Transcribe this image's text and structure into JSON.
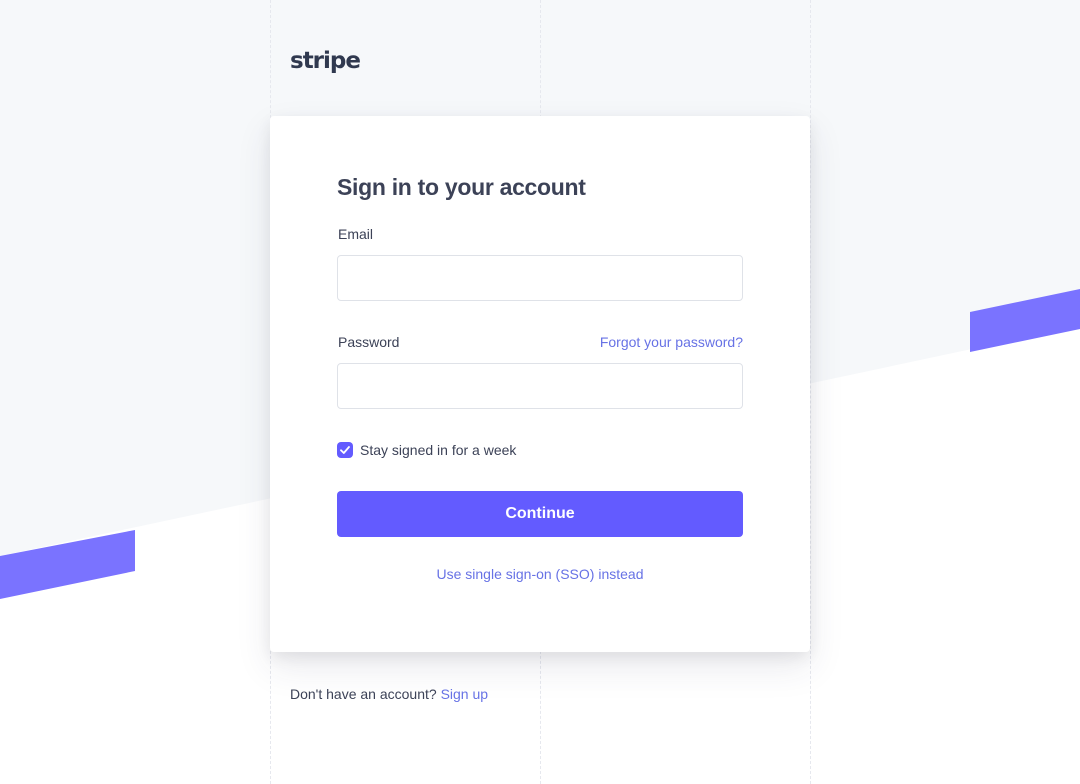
{
  "brand": {
    "logo_text": "stripe",
    "accent_color": "#635bff",
    "link_color": "#6772e5",
    "band_color": "#7a73ff",
    "text_color": "#3c4257",
    "background_color": "#f6f8fa"
  },
  "form": {
    "title": "Sign in to your account",
    "email": {
      "label": "Email",
      "value": "",
      "placeholder": ""
    },
    "password": {
      "label": "Password",
      "value": "",
      "placeholder": "",
      "forgot_link": "Forgot your password?"
    },
    "remember": {
      "label": "Stay signed in for a week",
      "checked": true,
      "icon": "check-icon"
    },
    "submit_label": "Continue",
    "sso_link": "Use single sign-on (SSO) instead"
  },
  "footer": {
    "prompt": "Don't have an account?",
    "signup_link": "Sign up"
  }
}
